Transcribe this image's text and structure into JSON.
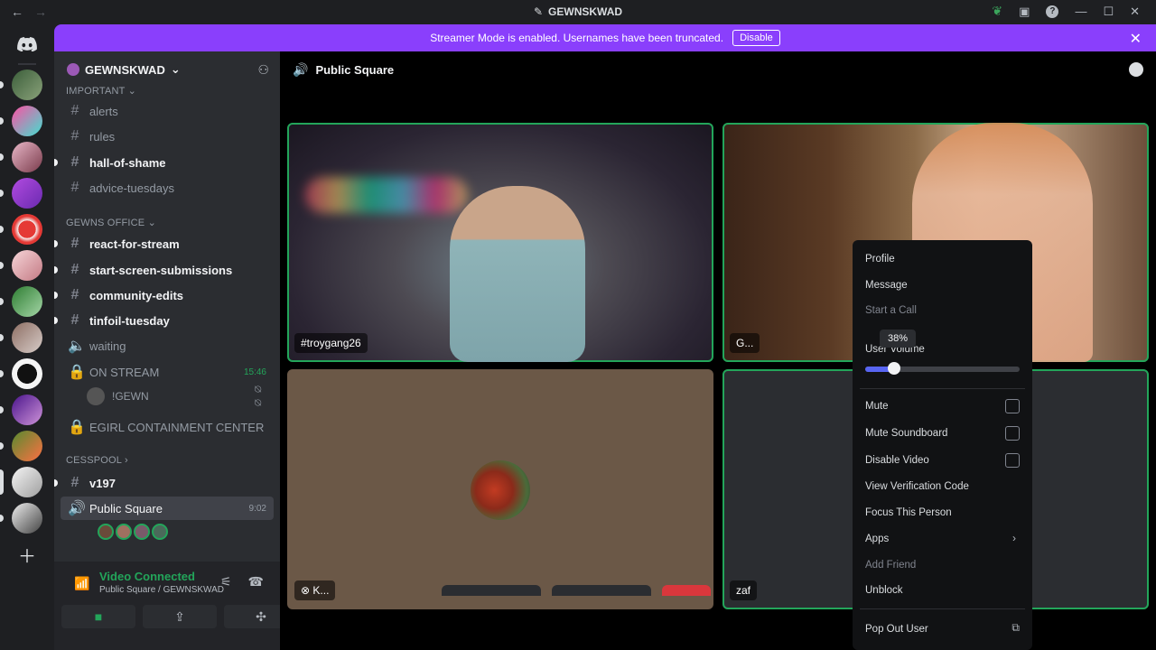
{
  "titlebar": {
    "back": "←",
    "forward": "→",
    "title": "GEWNSKWAD",
    "minimize": "—",
    "maximize": "☐",
    "close": "✕",
    "help": "?"
  },
  "banner": {
    "message": "Streamer Mode is enabled. Usernames have been truncated.",
    "disable_label": "Disable",
    "close": "✕"
  },
  "guild": {
    "name": "GEWNSKWAD",
    "chevron": "⌄"
  },
  "sidebar": {
    "categories": {
      "important": "IMPORTANT",
      "gewns_office": "GEWNS OFFICE",
      "cesspool": "CESSPOOL"
    },
    "channels": {
      "alerts": "alerts",
      "rules": "rules",
      "hall_of_shame": "hall-of-shame",
      "advice_tuesdays": "advice-tuesdays",
      "react_for_stream": "react-for-stream",
      "start_screen": "start-screen-submissions",
      "community_edits": "community-edits",
      "tinfoil_tuesday": "tinfoil-tuesday",
      "waiting": "waiting",
      "on_stream": "ON STREAM",
      "on_stream_time": "15:46",
      "on_stream_user": "!GEWN",
      "egirl": "EGIRL CONTAINMENT CENTER",
      "v197": "v197",
      "public_square": "Public Square",
      "public_square_time": "9:02"
    }
  },
  "voice_panel": {
    "status": "Video Connected",
    "location": "Public Square / GEWNSKWAD"
  },
  "main": {
    "channel_name": "Public Square"
  },
  "tiles": [
    {
      "label": "#troygang26"
    },
    {
      "label": "G..."
    },
    {
      "label": "K..."
    },
    {
      "label": "zaf"
    }
  ],
  "context_menu": {
    "profile": "Profile",
    "message": "Message",
    "start_call": "Start a Call",
    "user_volume": "User Volume",
    "volume_value": 38,
    "volume_tooltip": "38%",
    "mute": "Mute",
    "mute_soundboard": "Mute Soundboard",
    "disable_video": "Disable Video",
    "view_verification": "View Verification Code",
    "focus": "Focus This Person",
    "apps": "Apps",
    "add_friend": "Add Friend",
    "unblock": "Unblock",
    "pop_out": "Pop Out User"
  },
  "colors": {
    "accent": "#8a3ffc",
    "speaking": "#23a55a",
    "slider": "#5865f2"
  }
}
